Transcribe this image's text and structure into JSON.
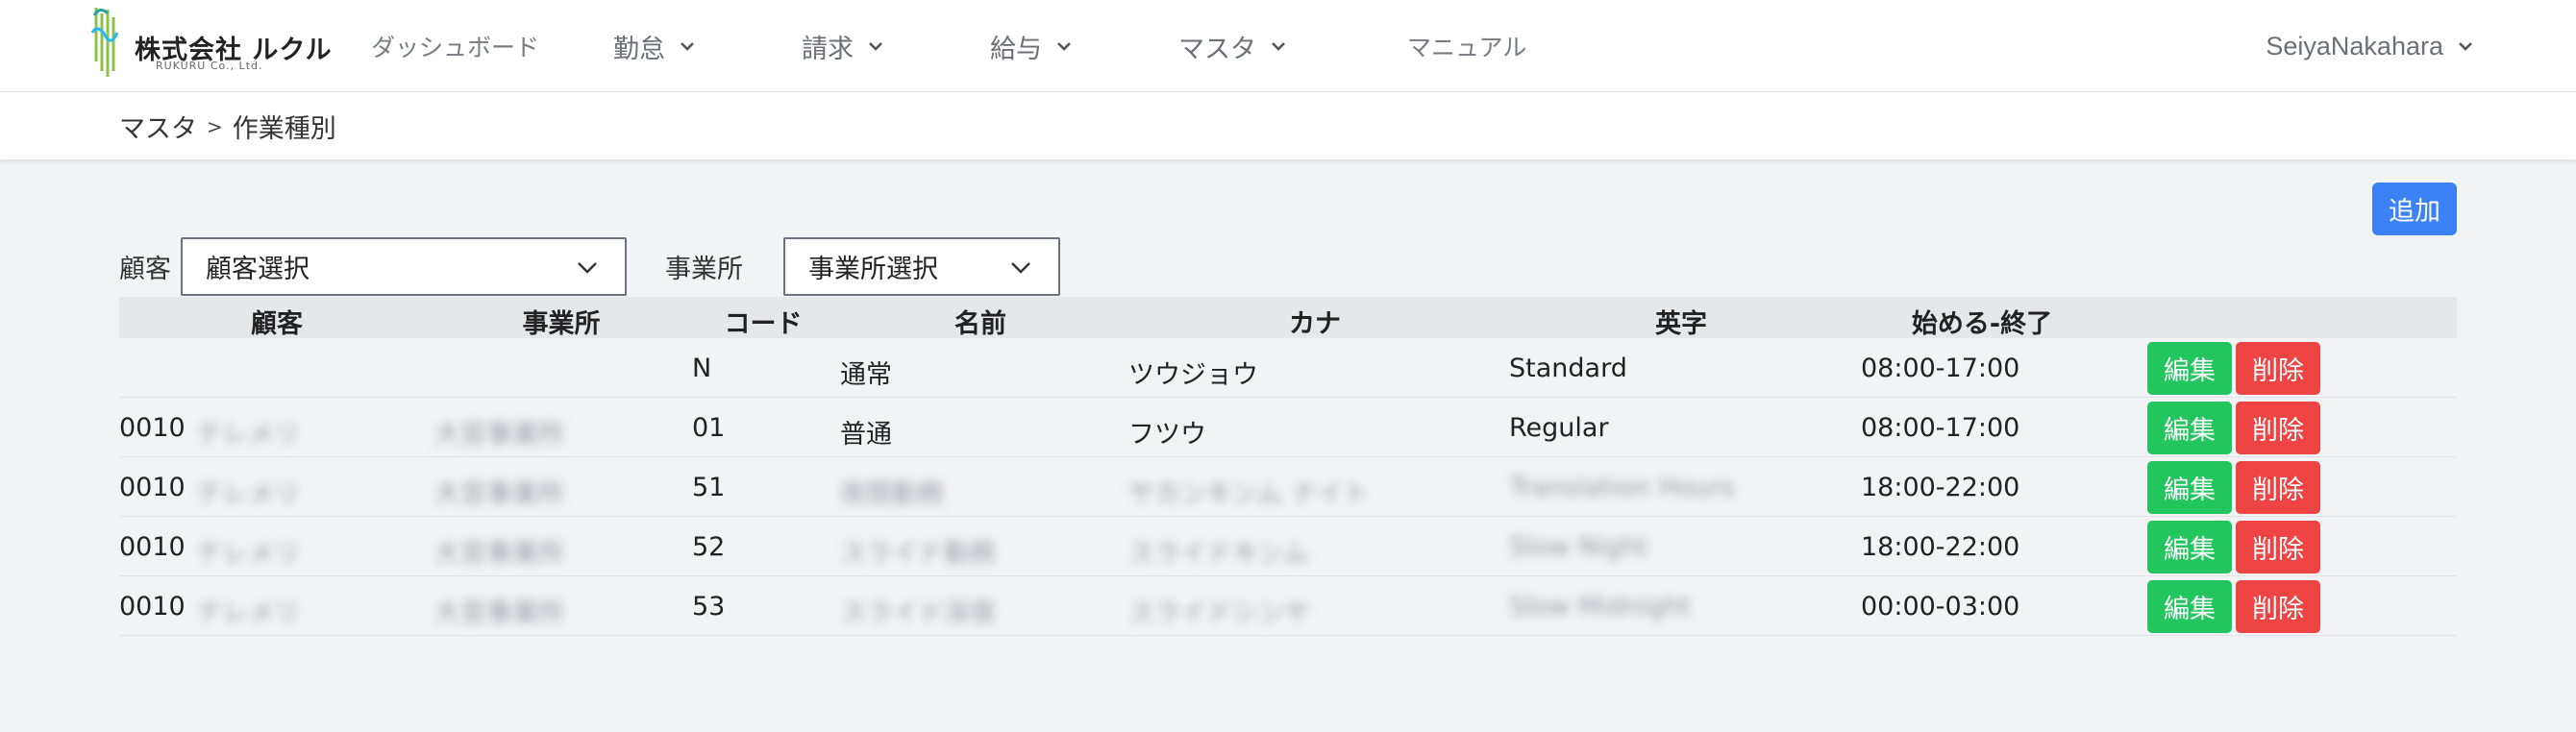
{
  "navbar": {
    "logo_main": "株式会社 ルクル",
    "logo_sub": "RUKURU Co., Ltd.",
    "items": [
      {
        "label": "ダッシュボード",
        "dropdown": false
      },
      {
        "label": "勤怠",
        "dropdown": true
      },
      {
        "label": "請求",
        "dropdown": true
      },
      {
        "label": "給与",
        "dropdown": true
      },
      {
        "label": "マスタ",
        "dropdown": true
      },
      {
        "label": "マニュアル",
        "dropdown": false
      }
    ],
    "user": "SeiyaNakahara"
  },
  "breadcrumb": {
    "parent": "マスタ",
    "separator": ">",
    "current": "作業種別"
  },
  "add_button": "追加",
  "filters": {
    "customer_label": "顧客",
    "customer_value": "顧客選択",
    "office_label": "事業所",
    "office_value": "事業所選択"
  },
  "table": {
    "headers": [
      "顧客",
      "事業所",
      "コード",
      "名前",
      "カナ",
      "英字",
      "始める-終了"
    ],
    "rows": [
      {
        "customer_code": "",
        "customer_name": "",
        "office": "",
        "code": "N",
        "name": "通常",
        "kana": "ツウジョウ",
        "english": "Standard",
        "time": "08:00-17:00",
        "blur": false
      },
      {
        "customer_code": "0010",
        "customer_name": "テレメリ",
        "office": "大宮事業所",
        "code": "01",
        "name": "普通",
        "kana": "フツウ",
        "english": "Regular",
        "time": "08:00-17:00",
        "blur": false
      },
      {
        "customer_code": "0010",
        "customer_name": "テレメリ",
        "office": "大宮事業所",
        "code": "51",
        "name": "夜間勤務",
        "kana": "ヤカンキンム ナイト",
        "english": "Translation Hours",
        "time": "18:00-22:00",
        "blur": true
      },
      {
        "customer_code": "0010",
        "customer_name": "テレメリ",
        "office": "大宮事業所",
        "code": "52",
        "name": "スライド勤務",
        "kana": "スライドキンム",
        "english": "Slow Night",
        "time": "18:00-22:00",
        "blur": true
      },
      {
        "customer_code": "0010",
        "customer_name": "テレメリ",
        "office": "大宮事業所",
        "code": "53",
        "name": "スライド深夜",
        "kana": "スライドシンヤ",
        "english": "Slow Midnight",
        "time": "00:00-03:00",
        "blur": true
      }
    ],
    "edit_label": "編集",
    "delete_label": "削除"
  },
  "colors": {
    "accent": "#3b82f6",
    "edit": "#22c55e",
    "delete": "#ef4444",
    "header_bg": "#e5e7eb",
    "page_bg": "#f2f3f5"
  },
  "icons": {
    "logo": "rukuru-hand-logo",
    "dropdown": "chevron-down-icon"
  }
}
